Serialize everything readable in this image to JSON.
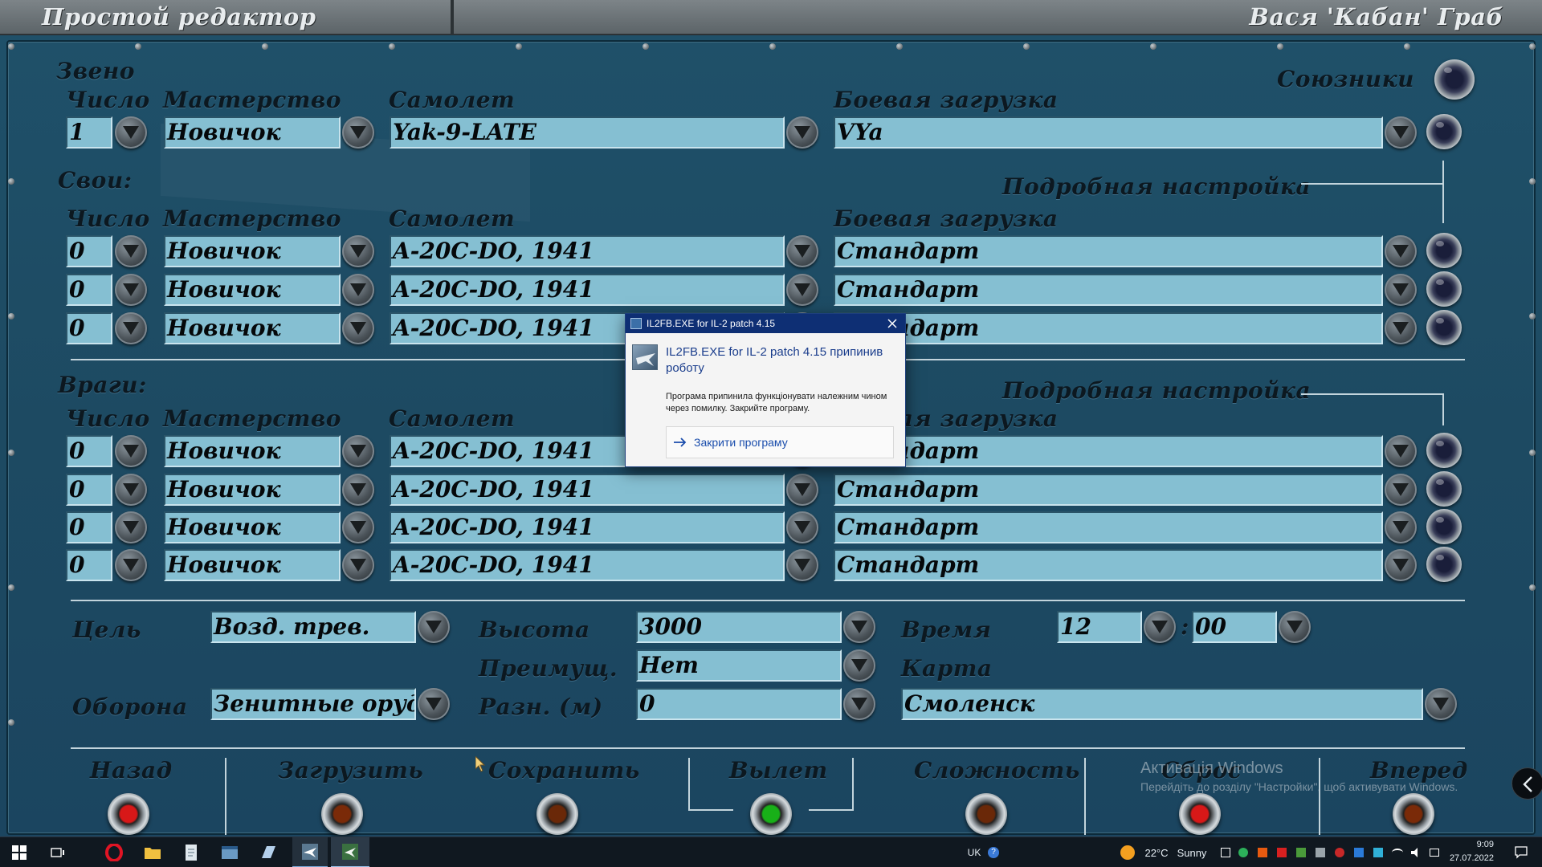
{
  "header": {
    "title": "Простой редактор",
    "user": "Вася 'Кабан' Граб"
  },
  "zveno": {
    "section": "Звено",
    "allies_label": "Союзники",
    "col_number": "Число",
    "col_skill": "Мастерство",
    "col_plane": "Самолет",
    "col_loadout": "Боевая загрузка",
    "row": {
      "number": "1",
      "skill": "Новичок",
      "plane": "Yak-9-LATE",
      "loadout": "VYa"
    }
  },
  "svoi": {
    "section": "Свои:",
    "detail": "Подробная настройка",
    "col_number": "Число",
    "col_skill": "Мастерство",
    "col_plane": "Самолет",
    "col_loadout": "Боевая загрузка",
    "rows": [
      {
        "number": "0",
        "skill": "Новичок",
        "plane": "A-20C-DO, 1941",
        "loadout": "Стандарт"
      },
      {
        "number": "0",
        "skill": "Новичок",
        "plane": "A-20C-DO, 1941",
        "loadout": "Стандарт"
      },
      {
        "number": "0",
        "skill": "Новичок",
        "plane": "A-20C-DO, 1941",
        "loadout": "Стандарт"
      }
    ]
  },
  "vragi": {
    "section": "Враги:",
    "detail": "Подробная настройка",
    "col_number": "Число",
    "col_skill": "Мастерство",
    "col_plane": "Самолет",
    "col_loadout": "Боевая загрузка",
    "rows": [
      {
        "number": "0",
        "skill": "Новичок",
        "plane": "A-20C-DO, 1941",
        "loadout": "Стандарт"
      },
      {
        "number": "0",
        "skill": "Новичок",
        "plane": "A-20C-DO, 1941",
        "loadout": "Стандарт"
      },
      {
        "number": "0",
        "skill": "Новичок",
        "plane": "A-20C-DO, 1941",
        "loadout": "Стандарт"
      },
      {
        "number": "0",
        "skill": "Новичок",
        "plane": "A-20C-DO, 1941",
        "loadout": "Стандарт"
      }
    ]
  },
  "mission": {
    "target_label": "Цель",
    "target": "Возд. трев.",
    "defense_label": "Оборона",
    "defense": "Зенитные оруди",
    "altitude_label": "Высота",
    "altitude": "3000",
    "advantage_label": "Преимущ.",
    "advantage": "Нет",
    "diff_label": "Разн. (м)",
    "diff": "0",
    "time_label": "Время",
    "time_h": "12",
    "time_sep": ":",
    "time_m": "00",
    "map_label": "Карта",
    "map": "Смоленск"
  },
  "bottom": {
    "back": "Назад",
    "load": "Загрузить",
    "save": "Сохранить",
    "fly": "Вылет",
    "difficulty": "Сложность",
    "reset": "Сброс",
    "forward": "Вперед",
    "lamp_colors": {
      "back": "#d81818",
      "load": "#7a2a08",
      "save": "#6a2808",
      "fly": "#18b018",
      "difficulty": "#6a2808",
      "reset": "#d81818",
      "forward": "#7a2a08"
    }
  },
  "watermark": {
    "line1": "Активація Windows",
    "line2": "Перейдіть до розділу \"Настройки\", щоб активувати Windows."
  },
  "dialog": {
    "title": "IL2FB.EXE for IL-2 patch 4.15",
    "heading": "IL2FB.EXE for IL-2 patch 4.15 припинив роботу",
    "body": "Програма припинила функціонувати належним чином через помилку. Закрийте програму.",
    "action": "Закрити програму"
  },
  "taskbar": {
    "lang": "UK",
    "temp": "22°C",
    "weather": "Sunny",
    "time": "9:09",
    "date": "27.07.2022"
  }
}
